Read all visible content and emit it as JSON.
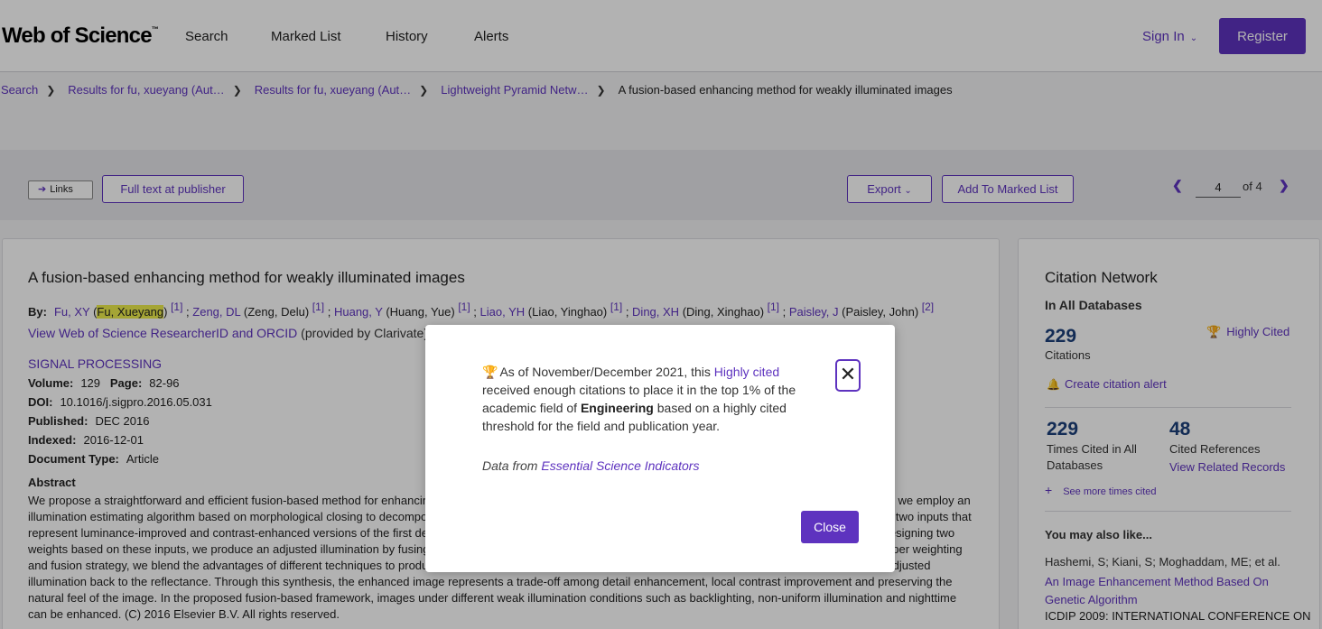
{
  "header": {
    "logo": "Web of Science",
    "logo_tm": "™",
    "nav": [
      "Search",
      "Marked List",
      "History",
      "Alerts"
    ],
    "sign_in": "Sign In",
    "register": "Register"
  },
  "breadcrumb": {
    "items": [
      "Search",
      "Results for fu, xueyang (Aut…",
      "Results for fu, xueyang (Aut…",
      "Lightweight Pyramid Netw…"
    ],
    "current": "A fusion-based enhancing method for weakly illuminated images"
  },
  "toolbar": {
    "links_label": "Links",
    "full_text": "Full text at publisher",
    "export": "Export",
    "add_marked": "Add To Marked List",
    "page_current": "4",
    "page_of": "of 4"
  },
  "article": {
    "title": "A fusion-based enhancing method for weakly illuminated images",
    "by_label": "By:",
    "authors": [
      {
        "short": "Fu, XY",
        "full": "Fu, Xueyang",
        "ref": "[1]",
        "sep": " ; "
      },
      {
        "short": "Zeng, DL",
        "full": "Zeng, Delu",
        "ref": "[1]",
        "sep": " ; "
      },
      {
        "short": "Huang, Y",
        "full": "Huang, Yue",
        "ref": "[1]",
        "sep": " ; "
      },
      {
        "short": "Liao, YH",
        "full": "Liao, Yinghao",
        "ref": "[1]",
        "sep": " ; "
      },
      {
        "short": "Ding, XH",
        "full": "Ding, Xinghao",
        "ref": "[1]",
        "sep": " ; "
      },
      {
        "short": "Paisley, J",
        "full": "Paisley, John",
        "ref": "[2]",
        "sep": ""
      }
    ],
    "researcher_link": "View Web of Science ResearcherID and ORCID",
    "researcher_rest": "(provided by Clarivate)",
    "journal": "SIGNAL PROCESSING",
    "volume_label": "Volume:",
    "volume": "129",
    "page_label": "Page:",
    "pages": "82-96",
    "doi_label": "DOI:",
    "doi": "10.1016/j.sigpro.2016.05.031",
    "published_label": "Published:",
    "published": "DEC 2016",
    "indexed_label": "Indexed:",
    "indexed": "2016-12-01",
    "doctype_label": "Document Type:",
    "doctype": "Article",
    "abstract_label": "Abstract",
    "abstract": "We propose a straightforward and efficient fusion-based method for enhancing weakly illuminated images that uses several mature image processing techniques. First, we employ an illumination estimating algorithm based on morphological closing to decompose an observed image into a reflectance image and an illumination image. We then derive two inputs that represent luminance-improved and contrast-enhanced versions of the first decomposed illumination using the sigmoid function and adaptive histogram equalization. Designing two weights based on these inputs, we produce an adjusted illumination by fusing the derived inputs with the corresponding weights in a multi-scale fashion. Through a proper weighting and fusion strategy, we blend the advantages of different techniques to produce the adjusted illumination. The final enhanced image is obtained by compensating the adjusted illumination back to the reflectance. Through this synthesis, the enhanced image represents a trade-off among detail enhancement, local contrast improvement and preserving the natural feel of the image. In the proposed fusion-based framework, images under different weak illumination conditions such as backlighting, non-uniform illumination and nighttime can be enhanced. (C) 2016 Elsevier B.V. All rights reserved."
  },
  "side": {
    "title": "Citation Network",
    "sub": "In All Databases",
    "citations": "229",
    "citations_label": "Citations",
    "highly_cited": "Highly Cited",
    "create_alert": "Create citation alert",
    "times_cited": "229",
    "times_cited_label": "Times Cited in All Databases",
    "cited_refs": "48",
    "cited_refs_label": "Cited References",
    "view_related": "View Related Records",
    "see_more": "See more times cited",
    "also_title": "You may also like...",
    "also_authors": "Hashemi, S; Kiani, S; Moghaddam, ME; et al.",
    "also_link": "An Image Enhancement Method Based On Genetic Algorithm",
    "also_conf": "ICDIP 2009: INTERNATIONAL CONFERENCE ON"
  },
  "modal": {
    "text_pre": "As of November/December 2021, this",
    "highly_cited_link": "Highly cited",
    "text_mid": "received enough citations to place it in the top 1% of the academic field of",
    "field": "Engineering",
    "text_post": "based on a highly cited threshold for the field and publication year.",
    "source_pre": "Data from",
    "source_link": "Essential Science Indicators",
    "close": "Close",
    "close_x": "✕"
  },
  "colors": {
    "accent": "#5e33bf",
    "number": "#1c3f7a",
    "trophy": "#d9693a",
    "highlight": "#ecec4c"
  },
  "icons": [
    "trophy-icon",
    "bell-icon",
    "plus-icon",
    "chevron-left-icon",
    "chevron-right-icon",
    "chevron-down-icon",
    "close-icon",
    "arrow-right-icon"
  ]
}
